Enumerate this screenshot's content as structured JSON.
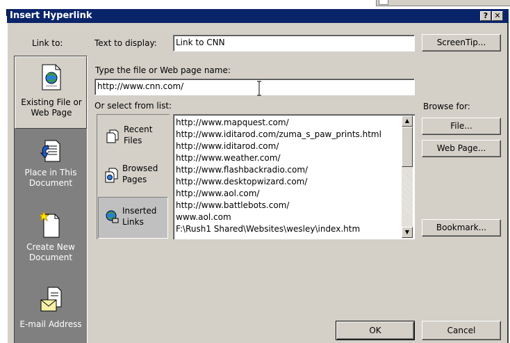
{
  "window": {
    "title": "Insert Hyperlink",
    "help_btn": "?",
    "close_btn": "✕"
  },
  "link_to_label": "Link to:",
  "sidebar": {
    "items": [
      {
        "label_line1": "Existing File or",
        "label_line2": "Web Page",
        "icon": "web-page-icon"
      },
      {
        "label_line1": "Place in This",
        "label_line2": "Document",
        "icon": "place-in-document-icon"
      },
      {
        "label_line1": "Create New",
        "label_line2": "Document",
        "icon": "new-document-icon"
      },
      {
        "label_line1": "E-mail Address",
        "label_line2": "",
        "icon": "email-icon"
      }
    ]
  },
  "text_to_display": {
    "label": "Text to display:",
    "value": "Link to CNN"
  },
  "screentip_button": "ScreenTip...",
  "address": {
    "label": "Type the file or Web page name:",
    "value": "http://www.cnn.com/"
  },
  "select_from_list_label": "Or select from list:",
  "browse_for_label": "Browse for:",
  "subnav": [
    {
      "line1": "Recent",
      "line2": "Files",
      "icon": "recent-files-icon"
    },
    {
      "line1": "Browsed",
      "line2": "Pages",
      "icon": "browsed-pages-icon"
    },
    {
      "line1": "Inserted",
      "line2": "Links",
      "icon": "inserted-links-icon"
    }
  ],
  "list_items": [
    "http://www.mapquest.com/",
    "http://www.iditarod.com/zuma_s_paw_prints.html",
    "http://www.iditarod.com/",
    "http://www.weather.com/",
    "http://www.flashbackradio.com/",
    "http://www.desktopwizard.com/",
    "http://www.aol.com/",
    "http://www.battlebots.com/",
    "www.aol.com",
    "F:\\Rush1 Shared\\Websites\\wesley\\index.htm"
  ],
  "buttons": {
    "file": "File...",
    "web_page": "Web Page...",
    "bookmark": "Bookmark...",
    "ok": "OK",
    "cancel": "Cancel"
  },
  "colors": {
    "titlebar": "#0a246a",
    "dialog": "#d4d0c8",
    "sidebar": "#808080"
  }
}
